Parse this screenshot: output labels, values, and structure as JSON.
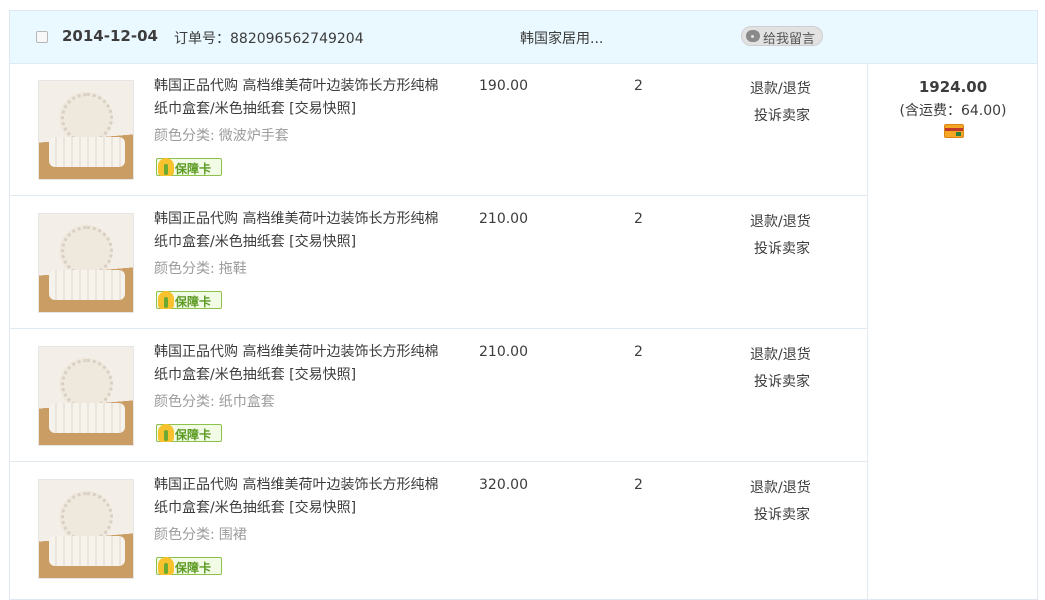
{
  "order": {
    "date": "2014-12-04",
    "order_no_label": "订单号：",
    "order_no": "882096562749204",
    "shop_name": "韩国家居用...",
    "message_button": "给我留言",
    "total": "1924.00",
    "shipping_note": "(含运费：64.00)"
  },
  "items": [
    {
      "title": "韩国正品代购 高档维美荷叶边装饰长方形纯棉纸巾盒套/米色抽纸套 [交易快照]",
      "sku_label": "颜色分类:",
      "sku_value": "微波炉手套",
      "guarantee": "保障卡",
      "price": "190.00",
      "qty": "2",
      "refund": "退款/退货",
      "complain": "投诉卖家"
    },
    {
      "title": "韩国正品代购 高档维美荷叶边装饰长方形纯棉纸巾盒套/米色抽纸套 [交易快照]",
      "sku_label": "颜色分类:",
      "sku_value": "拖鞋",
      "guarantee": "保障卡",
      "price": "210.00",
      "qty": "2",
      "refund": "退款/退货",
      "complain": "投诉卖家"
    },
    {
      "title": "韩国正品代购 高档维美荷叶边装饰长方形纯棉纸巾盒套/米色抽纸套 [交易快照]",
      "sku_label": "颜色分类:",
      "sku_value": "纸巾盒套",
      "guarantee": "保障卡",
      "price": "210.00",
      "qty": "2",
      "refund": "退款/退货",
      "complain": "投诉卖家"
    },
    {
      "title": "韩国正品代购 高档维美荷叶边装饰长方形纯棉纸巾盒套/米色抽纸套 [交易快照]",
      "sku_label": "颜色分类:",
      "sku_value": "围裙",
      "guarantee": "保障卡",
      "price": "320.00",
      "qty": "2",
      "refund": "退款/退货",
      "complain": "投诉卖家"
    }
  ],
  "icons": {
    "checkbox": "checkbox-icon",
    "message": "speech-bubble-icon",
    "guarantee": "shield-icon",
    "payment": "credit-card-icon"
  },
  "colors": {
    "header_bg": "#eaf8ff",
    "border": "#dfe8f2",
    "guarantee_green": "#5c9a22",
    "text": "#3c3c3c",
    "muted": "#9c9c9c"
  }
}
